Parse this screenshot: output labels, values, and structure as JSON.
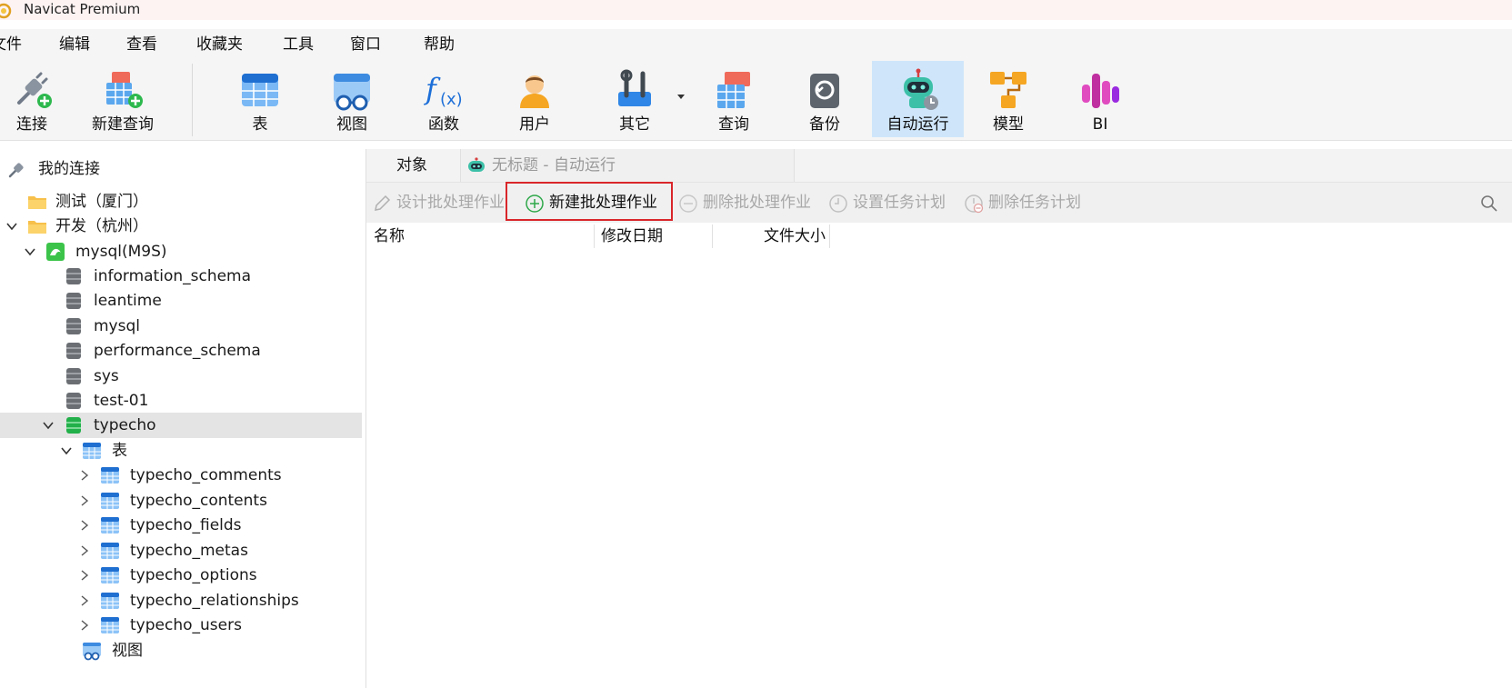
{
  "app": {
    "title": "Navicat Premium"
  },
  "menu": [
    "文件",
    "编辑",
    "查看",
    "收藏夹",
    "工具",
    "窗口",
    "帮助"
  ],
  "toolbar": {
    "items": [
      {
        "label": "连接",
        "icon": "connect-icon"
      },
      {
        "label": "新建查询",
        "icon": "new-query-icon"
      },
      {
        "label": "表",
        "icon": "table-icon"
      },
      {
        "label": "视图",
        "icon": "view-icon"
      },
      {
        "label": "函数",
        "icon": "function-icon"
      },
      {
        "label": "用户",
        "icon": "user-icon"
      },
      {
        "label": "其它",
        "icon": "tools-icon"
      },
      {
        "label": "查询",
        "icon": "query-icon"
      },
      {
        "label": "备份",
        "icon": "backup-icon"
      },
      {
        "label": "自动运行",
        "icon": "robot-icon",
        "active": true
      },
      {
        "label": "模型",
        "icon": "model-icon"
      },
      {
        "label": "BI",
        "icon": "bi-icon"
      }
    ]
  },
  "sidebar": {
    "header": "我的连接",
    "tree": [
      {
        "label": "测试（厦门）",
        "type": "folder"
      },
      {
        "label": "开发（杭州）",
        "type": "folder",
        "expanded": true
      },
      {
        "label": "mysql(M9S)",
        "type": "connection",
        "expanded": true
      },
      {
        "label": "information_schema",
        "type": "database"
      },
      {
        "label": "leantime",
        "type": "database"
      },
      {
        "label": "mysql",
        "type": "database"
      },
      {
        "label": "performance_schema",
        "type": "database"
      },
      {
        "label": "sys",
        "type": "database"
      },
      {
        "label": "test-01",
        "type": "database"
      },
      {
        "label": "typecho",
        "type": "database-open",
        "expanded": true,
        "selected": true
      },
      {
        "label": "表",
        "type": "tables-group",
        "expanded": true
      },
      {
        "label": "typecho_comments",
        "type": "table"
      },
      {
        "label": "typecho_contents",
        "type": "table"
      },
      {
        "label": "typecho_fields",
        "type": "table"
      },
      {
        "label": "typecho_metas",
        "type": "table"
      },
      {
        "label": "typecho_options",
        "type": "table"
      },
      {
        "label": "typecho_relationships",
        "type": "table"
      },
      {
        "label": "typecho_users",
        "type": "table"
      },
      {
        "label": "视图",
        "type": "views-group"
      }
    ]
  },
  "tabs": {
    "objects": "对象",
    "autorun": "无标题 - 自动运行"
  },
  "actions": {
    "design": "设计批处理作业",
    "new": "新建批处理作业",
    "delete": "删除批处理作业",
    "set_schedule": "设置任务计划",
    "delete_schedule": "删除任务计划"
  },
  "columns": {
    "name": "名称",
    "modified": "修改日期",
    "size": "文件大小"
  },
  "colors": {
    "accent": "#1e7fd9",
    "selection": "#cfe6fa",
    "highlight_border": "#d9262a"
  }
}
